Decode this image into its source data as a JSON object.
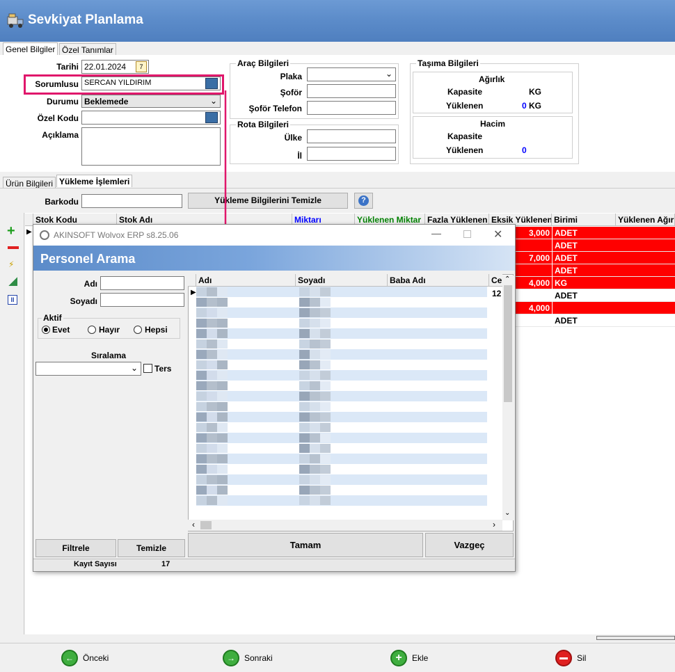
{
  "window": {
    "title": "Sevkiyat Planlama"
  },
  "tabs_top": [
    "Genel Bilgiler",
    "Özel Tanımlar"
  ],
  "genel": {
    "tarihi_label": "Tarihi",
    "tarihi_value": "22.01.2024",
    "sorumlusu_label": "Sorumlusu",
    "sorumlusu_value": "SERCAN YILDIRIM",
    "durumu_label": "Durumu",
    "durumu_value": "Beklemede",
    "ozel_kodu_label": "Özel Kodu",
    "ozel_kodu_value": "",
    "aciklama_label": "Açıklama",
    "aciklama_value": ""
  },
  "arac": {
    "title": "Araç Bilgileri",
    "plaka_label": "Plaka",
    "sofor_label": "Şoför",
    "sofor_tel_label": "Şoför Telefon"
  },
  "rota": {
    "title": "Rota Bilgileri",
    "ulke_label": "Ülke",
    "il_label": "İl"
  },
  "tasima": {
    "title": "Taşıma Bilgileri",
    "agirlik": {
      "title": "Ağırlık",
      "kapasite_label": "Kapasite",
      "kapasite_unit": "KG",
      "yuklenen_label": "Yüklenen",
      "yuklenen_value": "0",
      "yuklenen_unit": "KG"
    },
    "hacim": {
      "title": "Hacim",
      "kapasite_label": "Kapasite",
      "yuklenen_label": "Yüklenen",
      "yuklenen_value": "0"
    }
  },
  "tabs_mid": [
    "Ürün Bilgileri",
    "Yükleme İşlemleri"
  ],
  "barkod": {
    "label": "Barkodu",
    "value": "",
    "clear_button": "Yükleme Bilgilerini Temizle",
    "help_icon": "help-icon"
  },
  "main_grid": {
    "columns": [
      "Stok Kodu",
      "Stok Adı",
      "Miktarı",
      "Yüklenen Miktar",
      "Fazla Yüklenen",
      "Eksik Yüklenen",
      "Birimi",
      "Yüklenen Ağırlık"
    ],
    "rows": [
      {
        "eksik": "3,000",
        "birimi": "ADET",
        "red": true
      },
      {
        "eksik": "",
        "birimi": "ADET",
        "red": true
      },
      {
        "eksik": "7,000",
        "birimi": "ADET",
        "red": true
      },
      {
        "eksik": "",
        "birimi": "ADET",
        "red": true
      },
      {
        "eksik": "4,000",
        "birimi": "KG",
        "red": true
      },
      {
        "eksik": "",
        "birimi": "ADET",
        "red": false
      },
      {
        "eksik": "4,000",
        "birimi": "",
        "red": true
      },
      {
        "eksik": "",
        "birimi": "ADET",
        "red": false
      }
    ]
  },
  "toolbar_icons": [
    "add-icon",
    "remove-icon",
    "edit-icon",
    "excel-icon",
    "pause-icon"
  ],
  "dialog": {
    "title": "AKINSOFT Wolvox ERP s8.25.06",
    "header": "Personel Arama",
    "adi_label": "Adı",
    "soyadi_label": "Soyadı",
    "aktif_label": "Aktif",
    "aktif_options": [
      "Evet",
      "Hayır",
      "Hepsi"
    ],
    "aktif_selected": "Evet",
    "siralama_label": "Sıralama",
    "ters_label": "Ters",
    "grid_columns": [
      "Adı",
      "Soyadı",
      "Baba Adı",
      "Ce"
    ],
    "first_row_ce": "12",
    "filtrele": "Filtrele",
    "temizle": "Temizle",
    "tamam": "Tamam",
    "vazgec": "Vazgeç",
    "kayit_label": "Kayıt Sayısı",
    "kayit_value": "17"
  },
  "footer": {
    "onceki": "Önceki",
    "sonraki": "Sonraki",
    "ekle": "Ekle",
    "sil": "Sil"
  },
  "colors": {
    "header_blue": "#5b8bc9",
    "red_row": "#ff0000",
    "highlight": "#e0176b",
    "link_blue": "#0000ff"
  }
}
